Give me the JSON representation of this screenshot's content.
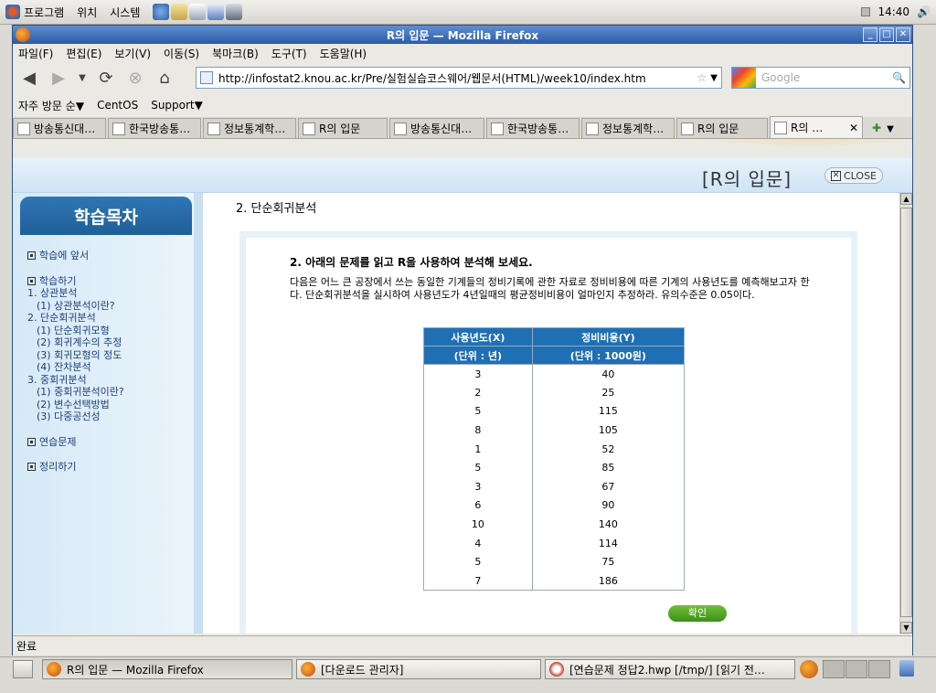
{
  "topbar": {
    "menus": [
      "프로그램",
      "위치",
      "시스템"
    ],
    "clock": "14:40"
  },
  "window": {
    "title": "R의 입문 — Mozilla Firefox",
    "menu": [
      "파일(F)",
      "편집(E)",
      "보기(V)",
      "이동(S)",
      "북마크(B)",
      "도구(T)",
      "도움말(H)"
    ],
    "url": "http://infostat2.knou.ac.kr/Pre/실험실습코스웨어/웹문서(HTML)/week10/index.htm",
    "search_placeholder": "Google",
    "bookmarks": [
      "자주 방문 순▼",
      "CentOS",
      "Support▼"
    ],
    "tabs": [
      "방송통신대…",
      "한국방송통…",
      "정보통계학…",
      "R의 입문",
      "방송통신대…",
      "한국방송통…",
      "정보통계학…",
      "R의 입문",
      "R의 …"
    ],
    "status": "완료"
  },
  "page": {
    "header_title": "[R의 입문]",
    "close_label": "CLOSE",
    "sidebar_title": "학습목차",
    "nav": {
      "intro": "학습에 앞서",
      "learn": "학습하기",
      "items": [
        {
          "label": "1. 상관분석",
          "level": 1
        },
        {
          "label": "(1) 상관분석이란?",
          "level": 2
        },
        {
          "label": "2. 단순회귀분석",
          "level": 1
        },
        {
          "label": "(1) 단순회귀모형",
          "level": 2
        },
        {
          "label": "(2) 회귀계수의 추정",
          "level": 2
        },
        {
          "label": "(3) 회귀모형의 정도",
          "level": 2
        },
        {
          "label": "(4) 잔차분석",
          "level": 2
        },
        {
          "label": "3. 중회귀분석",
          "level": 1
        },
        {
          "label": "(1) 중회귀분석이란?",
          "level": 2
        },
        {
          "label": "(2) 변수선택방법",
          "level": 2
        },
        {
          "label": "(3) 다중공선성",
          "level": 2
        }
      ],
      "practice": "연습문제",
      "summary": "정리하기"
    },
    "section_title": "2. 단순회귀분석",
    "question": "2. 아래의 문제를 읽고 R을 사용하여 분석해 보세요.",
    "description": "다음은 어느 큰 공장에서 쓰는 동일한 기계들의 정비기록에 관한 자료로 정비비용에 따른 기계의 사용년도를 예측해보고자 한다. 단순회귀분석을 실시하여 사용년도가 4년일때의 평균정비비용이 얼마인지 추정하라. 유의수준은 0.05이다.",
    "table": {
      "headers": [
        [
          "사용년도(X)",
          "(단위 : 년)"
        ],
        [
          "정비비용(Y)",
          "(단위 : 1000원)"
        ]
      ],
      "rows": [
        [
          3,
          40
        ],
        [
          2,
          25
        ],
        [
          5,
          115
        ],
        [
          8,
          105
        ],
        [
          1,
          52
        ],
        [
          5,
          85
        ],
        [
          3,
          67
        ],
        [
          6,
          90
        ],
        [
          10,
          140
        ],
        [
          4,
          114
        ],
        [
          5,
          75
        ],
        [
          7,
          186
        ]
      ]
    },
    "confirm": "확인"
  },
  "taskbar": {
    "items": [
      "R의 입문 — Mozilla Firefox",
      "[다운로드 관리자]",
      "[연습문제 정답2.hwp [/tmp/] [읽기 전…"
    ]
  }
}
